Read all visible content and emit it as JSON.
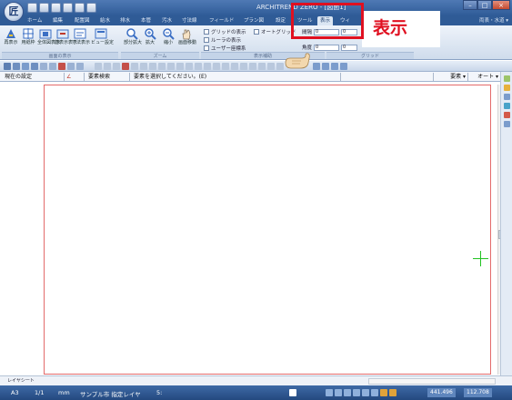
{
  "app": {
    "logo": "匠",
    "title": "ARCHITREND ZERO - [図面1]"
  },
  "ribbon": {
    "tabs": [
      "ホーム",
      "編集",
      "配置図",
      "給水",
      "排水",
      "本管",
      "汚水",
      "寸法線",
      "フィールド",
      "プラン図",
      "設定",
      "ツール",
      "表示",
      "ウィ"
    ],
    "active_tab": "表示",
    "right_label": "両表・水道 ▾",
    "groups": [
      {
        "label": "画面の表示",
        "buttons": [
          "再表示",
          "用紙枠",
          "全体図表示",
          "前表示表示",
          "寸法表示",
          "ビュー設定"
        ]
      },
      {
        "label": "ズーム",
        "buttons": [
          "部分拡大",
          "拡大",
          "縮小",
          "画面移動"
        ]
      },
      {
        "label": "表示補助",
        "checks": [
          "グリッドの表示",
          "オートグリッド",
          "ルーラの表示",
          "ユーザー座標系"
        ]
      },
      {
        "label": "グリッド",
        "fields": [
          {
            "label": "間隔",
            "value": "0"
          },
          {
            "label": "角度",
            "value": "0"
          }
        ]
      }
    ]
  },
  "callout": {
    "text": "表示",
    "highlight_color": "#e01020"
  },
  "statusrow": {
    "current_setting": "現在の設定",
    "element_search": "要素検索",
    "prompt": "要素を選択してください。(E)",
    "combo1": "要素 ▾",
    "combo2": "オート ▾"
  },
  "layerbar": {
    "layer_tab": "レイヤシート"
  },
  "statusbar": {
    "paper": "A3",
    "scale": "1/1",
    "unit": "mm",
    "project": "サンプル市 指定レイヤ",
    "layer_no": "5:",
    "coord_x": "441.496",
    "coord_y": "112.708"
  },
  "colors": {
    "sheet_border": "#e36a6a",
    "crosshair": "#22c322",
    "titlebar": "#2d5a96"
  }
}
